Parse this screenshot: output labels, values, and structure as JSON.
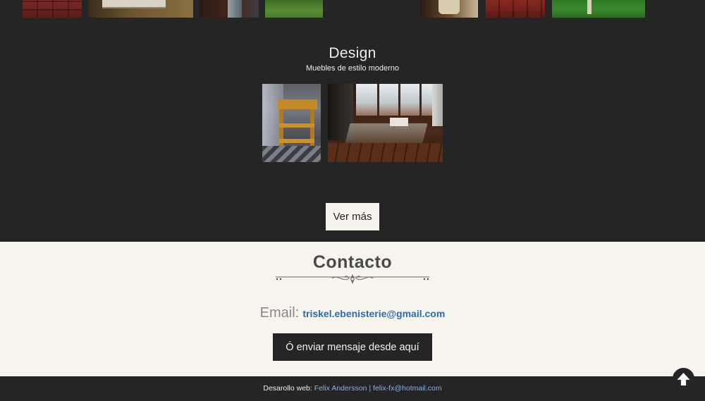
{
  "gallery": {
    "section_title": "Design",
    "section_subtitle": "Muebles de estilo moderno",
    "more_button_label": "Ver más"
  },
  "contact": {
    "title": "Contacto",
    "email_label": "Email:",
    "email_address": "triskel.ebenisterie@gmail.com",
    "send_button_label": "Ó enviar mensaje desde aquí"
  },
  "footer": {
    "prefix": "Desarollo web:",
    "developer_name": "Felix Andersson",
    "separator": " | ",
    "developer_email": "felix-fx@hotmail.com"
  },
  "icons": {
    "back_to_top": "arrow-up-icon",
    "ornament": "divider-ornament-icon"
  },
  "colors": {
    "dark_background": "#252525",
    "light_background": "#f7f4ee",
    "link_blue": "#2a6cb0",
    "footer_link": "#8ab0e8"
  }
}
